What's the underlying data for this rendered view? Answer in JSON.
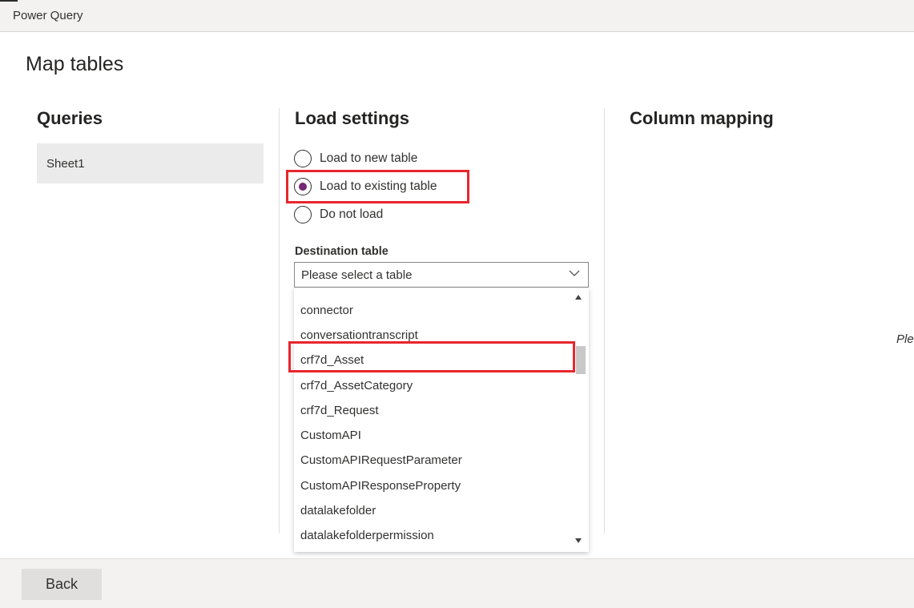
{
  "app": {
    "title": "Power Query"
  },
  "page": {
    "title": "Map tables"
  },
  "queries": {
    "heading": "Queries",
    "items": [
      "Sheet1"
    ]
  },
  "load_settings": {
    "heading": "Load settings",
    "options": [
      {
        "label": "Load to new table",
        "selected": false
      },
      {
        "label": "Load to existing table",
        "selected": true
      },
      {
        "label": "Do not load",
        "selected": false
      }
    ],
    "destination_label": "Destination table",
    "destination_placeholder": "Please select a table",
    "dropdown_items": [
      "connector",
      "conversationtranscript",
      "crf7d_Asset",
      "crf7d_AssetCategory",
      "crf7d_Request",
      "CustomAPI",
      "CustomAPIRequestParameter",
      "CustomAPIResponseProperty",
      "datalakefolder",
      "datalakefolderpermission"
    ]
  },
  "column_mapping": {
    "heading": "Column mapping",
    "truncated_text": "Ple"
  },
  "footer": {
    "back_label": "Back"
  },
  "colors": {
    "accent": "#742774",
    "highlight": "#e8262d"
  }
}
